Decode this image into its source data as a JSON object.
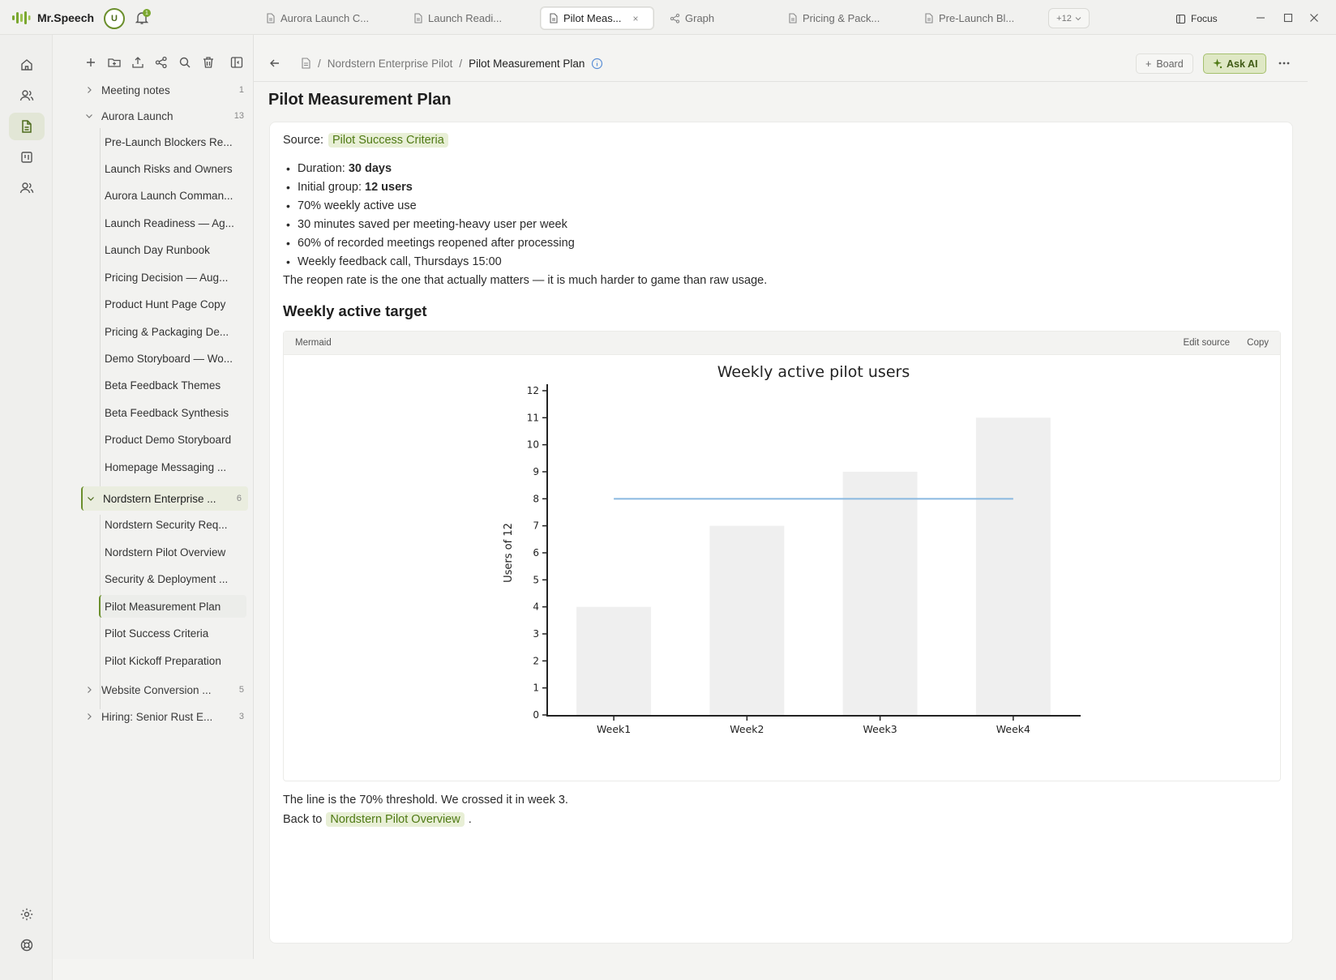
{
  "app": {
    "name": "Mr.Speech",
    "avatar_initial": "U",
    "notification_count": "1"
  },
  "tabs": [
    {
      "label": "Aurora Launch C...",
      "icon": "document-icon"
    },
    {
      "label": "Launch Readi...",
      "icon": "document-icon"
    },
    {
      "label": "Pilot Meas...",
      "icon": "document-icon",
      "active": true
    },
    {
      "label": "Graph",
      "icon": "graph-icon"
    },
    {
      "label": "Pricing & Pack...",
      "icon": "document-icon"
    },
    {
      "label": "Pre-Launch Bl...",
      "icon": "document-icon"
    }
  ],
  "tabs_more": "+12",
  "focus_label": "Focus",
  "sidebar": {
    "groups": [
      {
        "label": "Meeting notes",
        "count": "1",
        "expanded": false
      },
      {
        "label": "Aurora Launch",
        "count": "13",
        "expanded": true,
        "items": [
          "Pre-Launch Blockers Re...",
          "Launch Risks and Owners",
          "Aurora Launch Comman...",
          "Launch Readiness — Ag...",
          "Launch Day Runbook",
          "Pricing Decision — Aug...",
          "Product Hunt Page Copy",
          "Pricing & Packaging De...",
          "Demo Storyboard — Wo...",
          "Beta Feedback Themes",
          "Beta Feedback Synthesis",
          "Product Demo Storyboard",
          "Homepage Messaging ..."
        ]
      },
      {
        "label": "Nordstern Enterprise ...",
        "count": "6",
        "expanded": true,
        "active": true,
        "items": [
          "Nordstern Security Req...",
          "Nordstern Pilot Overview",
          "Security & Deployment ...",
          "Pilot Measurement Plan",
          "Pilot Success Criteria",
          "Pilot Kickoff Preparation"
        ]
      },
      {
        "label": "Website Conversion ...",
        "count": "5",
        "expanded": false
      },
      {
        "label": "Hiring: Senior Rust E...",
        "count": "3",
        "expanded": false
      }
    ]
  },
  "breadcrumb": {
    "parent": "Nordstern Enterprise Pilot",
    "separator": "/",
    "current": "Pilot Measurement Plan"
  },
  "header_actions": {
    "board": "Board",
    "ask_ai": "Ask AI"
  },
  "doc": {
    "title": "Pilot Measurement Plan",
    "source_label": "Source:",
    "source_link": "Pilot Success Criteria",
    "bullets": [
      {
        "text": "Duration:",
        "bold": "30 days"
      },
      {
        "text": "Initial group:",
        "bold": "12 users"
      },
      {
        "text": "70% weekly active use",
        "bold": ""
      },
      {
        "text": "30 minutes saved per meeting-heavy user per week",
        "bold": ""
      },
      {
        "text": "60% of recorded meetings reopened after processing",
        "bold": ""
      },
      {
        "text": "Weekly feedback call, Thursdays 15:00",
        "bold": ""
      }
    ],
    "summary": "The reopen rate is the one that actually matters — it is much harder to game than raw usage.",
    "section_title": "Weekly active target",
    "mermaid": {
      "label": "Mermaid",
      "edit_source": "Edit source",
      "copy": "Copy"
    },
    "footer_text": "The line is the 70% threshold. We crossed it in week 3.",
    "back_prefix": "Back to",
    "back_link": "Nordstern Pilot Overview",
    "back_suffix": "."
  },
  "chart_data": {
    "type": "bar",
    "title": "Weekly active pilot users",
    "xlabel": "",
    "ylabel": "Users of 12",
    "categories": [
      "Week1",
      "Week2",
      "Week3",
      "Week4"
    ],
    "series": [
      {
        "type": "bar",
        "values": [
          4,
          7,
          9,
          11
        ]
      },
      {
        "type": "line",
        "values": [
          8,
          8,
          8,
          8
        ]
      }
    ],
    "ylim": [
      0,
      12
    ],
    "yticks": [
      0,
      1,
      2,
      3,
      4,
      5,
      6,
      7,
      8,
      9,
      10,
      11,
      12
    ],
    "grid": false,
    "colors": {
      "bar": "#efefef",
      "line": "#8ab9e0",
      "axis": "#222222"
    }
  },
  "colors": {
    "accent": "#6b8f2c",
    "chip_bg": "#e8efd6",
    "chip_text": "#4f7a14"
  }
}
